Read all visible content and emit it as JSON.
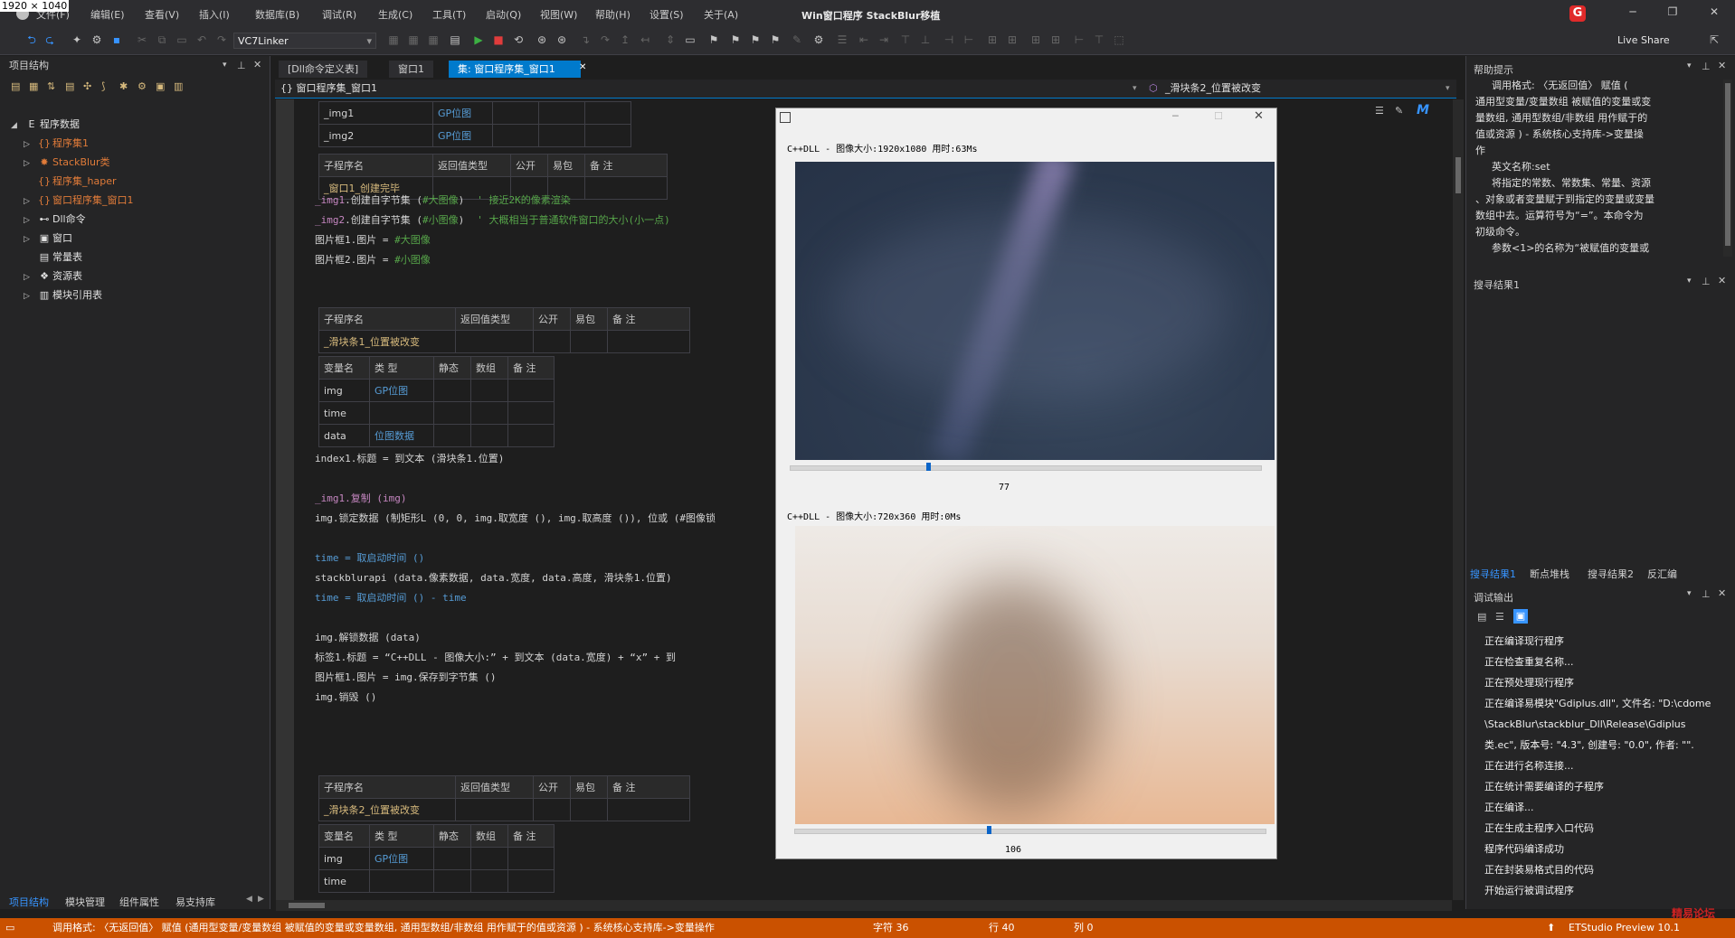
{
  "resolution": "1920 × 1040",
  "window_title": "Win窗口程序 StackBlur移植",
  "menu": [
    "文件(F)",
    "编辑(E)",
    "查看(V)",
    "插入(I)",
    "数据库(B)",
    "调试(R)",
    "生成(C)",
    "工具(T)",
    "启动(Q)",
    "视图(W)",
    "帮助(H)",
    "设置(S)",
    "关于(A)"
  ],
  "toolbar": {
    "linker": "VC7Linker",
    "live_share": "Live Share"
  },
  "left_panel": {
    "title": "项目结构",
    "tree": [
      {
        "label": "程序数据",
        "icon": "E",
        "color": "#e0e0e0"
      },
      {
        "label": "程序集1",
        "icon": "{}",
        "color": "#e07b39"
      },
      {
        "label": "StackBlur类",
        "icon": "✸",
        "color": "#e07b39"
      },
      {
        "label": "程序集_haper",
        "icon": "{}",
        "color": "#e07b39"
      },
      {
        "label": "窗口程序集_窗口1",
        "icon": "{}",
        "color": "#e07b39"
      },
      {
        "label": "Dll命令",
        "icon": "⊷",
        "color": "#e0e0e0"
      },
      {
        "label": "窗口",
        "icon": "▣",
        "color": "#e0e0e0"
      },
      {
        "label": "常量表",
        "icon": "▤",
        "color": "#e0e0e0"
      },
      {
        "label": "资源表",
        "icon": "❖",
        "color": "#e0e0e0"
      },
      {
        "label": "模块引用表",
        "icon": "▥",
        "color": "#e0e0e0"
      }
    ],
    "bottom_tabs": [
      "项目结构",
      "模块管理",
      "组件属性",
      "易支持库"
    ]
  },
  "tabs": [
    "[Dll命令定义表]",
    "窗口1",
    "集: 窗口程序集_窗口1"
  ],
  "path": {
    "left": "{} 窗口程序集_窗口1",
    "right": "_滑块条2_位置被改变"
  },
  "code": {
    "vars_top": [
      [
        "_img1",
        "GP位图"
      ],
      [
        "_img2",
        "GP位图"
      ]
    ],
    "sub_headers": [
      "子程序名",
      "返回值类型",
      "公开",
      "易包",
      "备 注"
    ],
    "var_headers": [
      "变量名",
      "类 型",
      "静态",
      "数组",
      "备 注"
    ],
    "sub1_name": "_窗口1_创建完毕",
    "lines1": [
      {
        "a": "_img1",
        "b": ".创建自字节集 (",
        "c": "#大图像",
        "d": ")",
        "e": "' 接近2K的像素渲染"
      },
      {
        "a": "_img2",
        "b": ".创建自字节集 (",
        "c": "#小图像",
        "d": ")",
        "e": "' 大概相当于普通软件窗口的大小(小一点)"
      },
      {
        "a": "图片框1",
        "b": ".图片 = ",
        "c": "#大图像",
        "d": "",
        "e": ""
      },
      {
        "a": "图片框2",
        "b": ".图片 = ",
        "c": "#小图像",
        "d": "",
        "e": ""
      }
    ],
    "sub2_name": "_滑块条1_位置被改变",
    "vars_sub2": [
      [
        "img",
        "GP位图"
      ],
      [
        "time",
        ""
      ],
      [
        "data",
        "位图数据"
      ]
    ],
    "line_index": "index1.标题 = 到文本 (滑块条1.位置)",
    "lines2": [
      "_img1.复制 (img)",
      "img.锁定数据 (制矩形L (0, 0, img.取宽度 (), img.取高度 ()), 位或 (#图像锁",
      "",
      "time = 取启动时间 ()",
      "stackblurapi (data.像素数据, data.宽度, data.高度, 滑块条1.位置)",
      "time = 取启动时间 () - time",
      "",
      "img.解锁数据 (data)",
      "标签1.标题 = “C++DLL - 图像大小:” + 到文本 (data.宽度) + “x” + 到",
      "图片框1.图片 = img.保存到字节集 ()",
      "img.销毁 ()"
    ],
    "sub3_name": "_滑块条2_位置被改变",
    "vars_sub3": [
      [
        "img",
        "GP位图"
      ],
      [
        "time",
        ""
      ]
    ]
  },
  "popup": {
    "label1": "C++DLL - 图像大小:1920x1080  用时:63Ms",
    "value1": "77",
    "slider1_fraction": 0.29,
    "label2": "C++DLL - 图像大小:720x360  用时:0Ms",
    "value2": "106",
    "slider2_fraction": 0.41
  },
  "right_panel": {
    "help_title": "帮助提示",
    "help_lines": [
      "调用格式: 〈无返回值〉 赋值 (",
      "通用型变量/变量数组 被赋值的变量或变",
      "量数组, 通用型数组/非数组 用作赋于的",
      "值或资源 ) - 系统核心支持库->变量操",
      "作",
      "英文名称:set",
      "将指定的常数、常数集、常量、资源",
      "、对象或者变量赋于到指定的变量或变量",
      "数组中去。运算符号为“=”。本命令为",
      "初级命令。",
      "参数<1>的名称为“被赋值的变量或"
    ],
    "search_title": "搜寻结果1",
    "search_tabs": [
      "搜寻结果1",
      "断点堆栈",
      "搜寻结果2",
      "反汇编"
    ],
    "output_title": "调试输出",
    "output_lines": [
      "正在编译现行程序",
      "正在检查重复名称...",
      "正在预处理现行程序",
      "正在编译易模块\"Gdiplus.dll\", 文件名: \"D:\\cdome",
      "\\StackBlur\\stackblur_Dll\\Release\\Gdiplus",
      "类.ec\", 版本号: \"4.3\", 创建号: \"0.0\", 作者: \"\".",
      "正在进行名称连接...",
      "正在统计需要编译的子程序",
      "正在编译...",
      "正在生成主程序入口代码",
      "程序代码编译成功",
      "正在封装易格式目的代码",
      "开始运行被调试程序"
    ]
  },
  "status": {
    "text": "调用格式: 〈无返回值〉 赋值 (通用型变量/变量数组 被赋值的变量或变量数组, 通用型数组/非数组 用作赋于的值或资源 ) - 系统核心支持库->变量操作",
    "col_chars": "字符 36",
    "row": "行 40",
    "col": "列 0",
    "app": "ETStudio Preview 10.1"
  },
  "watermark": "精易论坛"
}
